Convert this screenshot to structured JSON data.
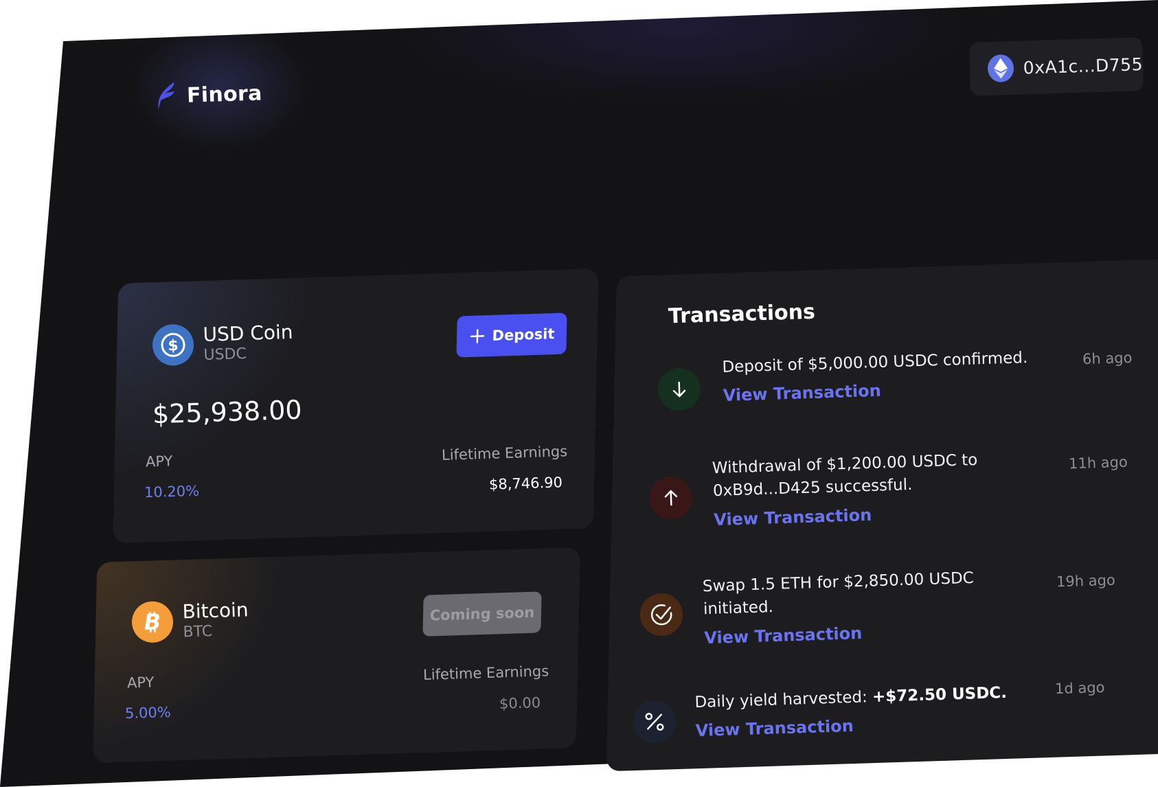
{
  "app": {
    "brand": "Finora"
  },
  "wallet": {
    "address": "0xA1c...D755"
  },
  "assets": [
    {
      "name": "USD Coin",
      "symbol": "USDC",
      "balance": "$25,938.00",
      "apy_label": "APY",
      "apy_value": "10.20%",
      "earnings_label": "Lifetime Earnings",
      "earnings_value": "$8,746.90",
      "action_label": "Deposit",
      "color": "#3e73c4"
    },
    {
      "name": "Bitcoin",
      "symbol": "BTC",
      "apy_label": "APY",
      "apy_value": "5.00%",
      "earnings_label": "Lifetime Earnings",
      "earnings_value": "$0.00",
      "action_label": "Coming soon",
      "color": "#f49d3b"
    }
  ],
  "transactions": {
    "title": "Transactions",
    "items": [
      {
        "text": "Deposit of $5,000.00 USDC confirmed.",
        "link": "View Transaction",
        "time": "6h ago",
        "icon": "arrow-down-icon"
      },
      {
        "text_line1": "Withdrawal of $1,200.00 USDC to",
        "text_line2": "0xB9d...D425 successful.",
        "link": "View Transaction",
        "time": "11h ago",
        "icon": "arrow-up-icon"
      },
      {
        "text_line1": "Swap 1.5 ETH for $2,850.00 USDC",
        "text_line2": "initiated.",
        "link": "View Transaction",
        "time": "19h ago",
        "icon": "check-circle-icon"
      },
      {
        "text_prefix": "Daily yield harvested: ",
        "text_bold": "+$72.50 USDC.",
        "link": "View Transaction",
        "time": "1d ago",
        "icon": "percent-icon"
      }
    ]
  }
}
